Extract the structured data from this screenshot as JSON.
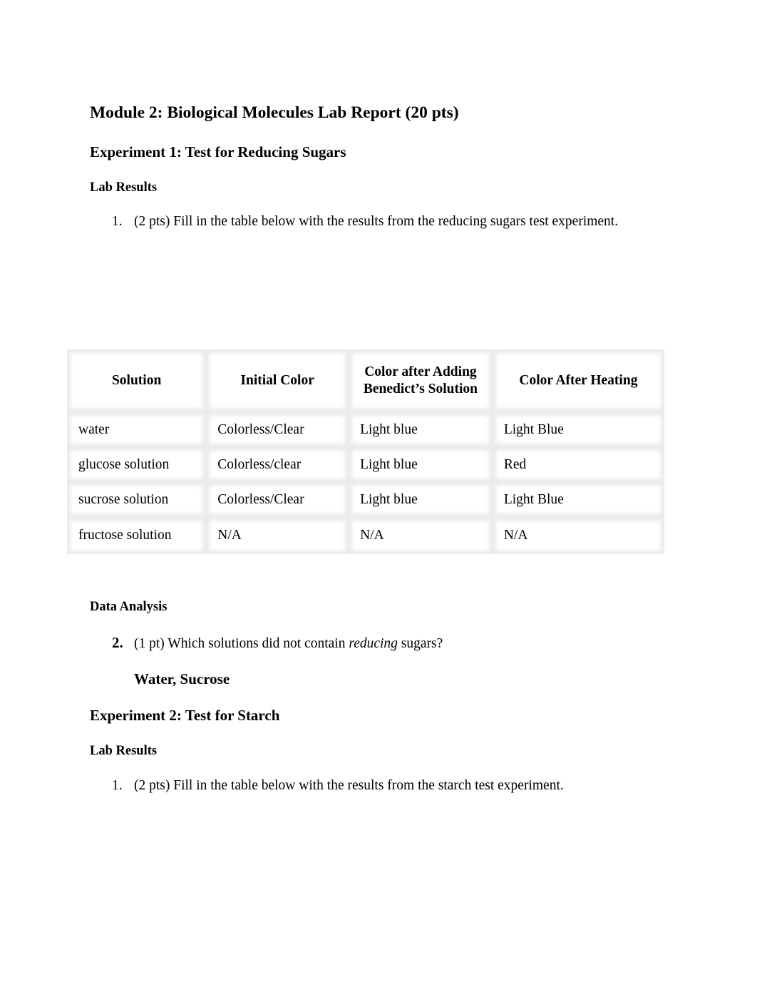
{
  "document": {
    "title": "Module 2: Biological Molecules Lab Report (20 pts)",
    "experiment1": {
      "heading": "Experiment 1: Test for Reducing Sugars",
      "lab_results_heading": "Lab Results",
      "question1": {
        "number": "1.",
        "text": "(2 pts) Fill in the table below with the results from the reducing sugars test experiment."
      },
      "table": {
        "headers": [
          "Solution",
          "Initial Color",
          "Color after Adding Benedict’s Solution",
          "Color After Heating"
        ],
        "rows": [
          [
            "water",
            "Colorless/Clear",
            "Light blue",
            "Light Blue"
          ],
          [
            "glucose solution",
            "Colorless/clear",
            "Light blue",
            "Red"
          ],
          [
            "sucrose solution",
            "Colorless/Clear",
            "Light blue",
            "Light Blue"
          ],
          [
            "fructose solution",
            "N/A",
            "N/A",
            "N/A"
          ]
        ]
      },
      "data_analysis_heading": "Data Analysis",
      "question2": {
        "number": "2.",
        "text_before": "(1 pt) Which solutions did not contain ",
        "text_italic": "reducing",
        "text_after": " sugars?",
        "answer": "Water, Sucrose"
      }
    },
    "experiment2": {
      "heading": "Experiment 2: Test for Starch",
      "lab_results_heading": "Lab Results",
      "question1": {
        "number": "1.",
        "text": "(2 pts) Fill in the table below with the results from the starch test experiment."
      }
    }
  }
}
